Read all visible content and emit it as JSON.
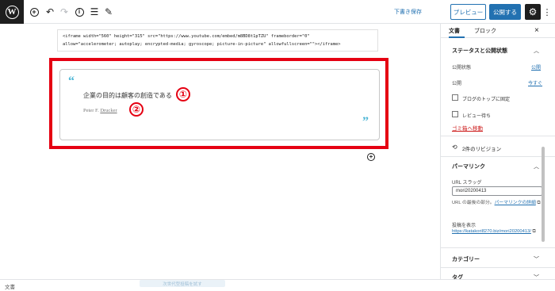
{
  "toolbar": {
    "draft_save": "下書き保存",
    "preview": "プレビュー",
    "publish": "公開する"
  },
  "editor": {
    "code": {
      "line1": "<iframe width=\"560\" height=\"315\" src=\"https://www.youtube.com/embed/m8BD8t1pTZU\" frameborder=\"0\"",
      "line2": "allow=\"accelerometer; autoplay; encrypted-media; gyroscope; picture-in-picture\" allowfullscreen=\"\"></iframe>"
    },
    "quote": {
      "open_mark": "“",
      "close_mark": "”",
      "text": "企業の目的は顧客の創造である",
      "cite_name": "Peter F. ",
      "cite_link": "Drucker"
    },
    "markers": [
      "①",
      "②"
    ]
  },
  "sidebar": {
    "tabs": [
      "文書",
      "ブロック"
    ],
    "status_panel": {
      "title": "ステータスと公開状態",
      "visibility_label": "公開状態",
      "visibility_value": "公開",
      "publish_label": "公開",
      "publish_value": "今すぐ",
      "stick_top": "ブログのトップに固定",
      "pending_review": "レビュー待ち",
      "trash": "ゴミ箱へ移動"
    },
    "revisions": "2件のリビジョン",
    "permalink_panel": {
      "title": "パーマリンク",
      "slug_label": "URL スラッグ",
      "slug_value": "mori20200413",
      "help_prefix": "URL の最後の部分。",
      "help_link": "パーマリンクの詳細",
      "view_label": "投稿を表示",
      "view_url": "https://katakori8270.biz/mori20200413/"
    },
    "category_title": "カテゴリー",
    "tag_title": "タグ"
  },
  "status": {
    "label": "文書",
    "faded": "次世代型投稿を試す"
  }
}
